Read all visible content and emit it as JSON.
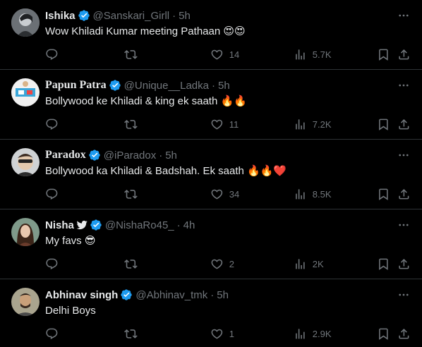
{
  "colors": {
    "background": "#000000",
    "text": "#e7e9ea",
    "muted": "#71767b",
    "verified": "#1d9bf0",
    "divider": "#2f3336"
  },
  "tweets": [
    {
      "name": "Ishika",
      "handle": "@Sanskari_Girll",
      "dot": "·",
      "time": "5h",
      "text": "Wow Khiladi Kumar meeting Pathaan",
      "emojis": "😍😍",
      "replies": "",
      "retweets": "",
      "likes": "14",
      "views": "5.7K"
    },
    {
      "name": "Papun Patra",
      "handle": "@Unique__Ladka",
      "dot": "·",
      "time": "5h",
      "text": "Bollywood ke Khiladi & king ek saath",
      "emojis": "🔥🔥",
      "replies": "",
      "retweets": "",
      "likes": "11",
      "views": "7.2K"
    },
    {
      "name": "Paradox",
      "handle": "@iParadox",
      "dot": "·",
      "time": "5h",
      "text": "Bollywood ka Khiladi & Badshah. Ek saath",
      "emojis": "🔥🔥❤️",
      "replies": "",
      "retweets": "",
      "likes": "34",
      "views": "8.5K"
    },
    {
      "name": "Nisha",
      "handle": "@NishaRo45_",
      "dot": "·",
      "time": "4h",
      "text": "My favs",
      "emojis": "😎",
      "replies": "",
      "retweets": "",
      "likes": "2",
      "views": "2K"
    },
    {
      "name": "Abhinav singh",
      "handle": "@Abhinav_tmk",
      "dot": "·",
      "time": "5h",
      "text": "Delhi Boys",
      "emojis": "",
      "replies": "",
      "retweets": "",
      "likes": "1",
      "views": "2.9K"
    }
  ]
}
